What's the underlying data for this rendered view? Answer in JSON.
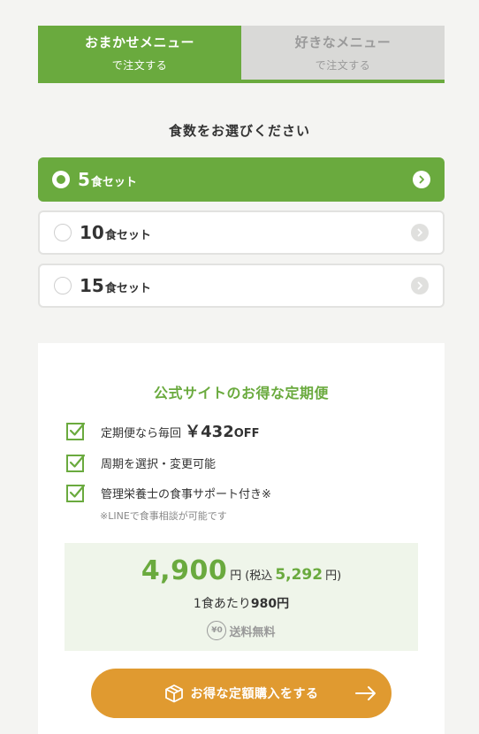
{
  "tabs": [
    {
      "line1": "おまかせメニュー",
      "line2": "で注文する"
    },
    {
      "line1": "好きなメニュー",
      "line2": "で注文する"
    }
  ],
  "quantity": {
    "heading": "食数をお選びください",
    "options": [
      {
        "num": "5",
        "unit": "食セット"
      },
      {
        "num": "10",
        "unit": "食セット"
      },
      {
        "num": "15",
        "unit": "食セット"
      }
    ]
  },
  "plan": {
    "title": "公式サイトのお得な定期便",
    "features": {
      "f1_text": "定期便なら毎回",
      "f1_price": "￥432",
      "f1_off": "OFF",
      "f2_text": "周期を選択・変更可能",
      "f3_text": "管理栄養士の食事サポート付き※"
    },
    "note": "※LINEで食事相談が可能です",
    "price": {
      "main": "4,900",
      "yen": "円",
      "tax_label": "(税込",
      "tax_value": "5,292",
      "tax_close": "円)",
      "per_meal_prefix": "1食あたり",
      "per_meal_value": "980円",
      "shipping_icon": "¥0",
      "shipping_text": "送料無料"
    },
    "buy_label": "お得な定額購入をする"
  },
  "colors": {
    "green": "#6aaa3e",
    "orange": "#e09a30",
    "bg": "#f4f4f2"
  }
}
